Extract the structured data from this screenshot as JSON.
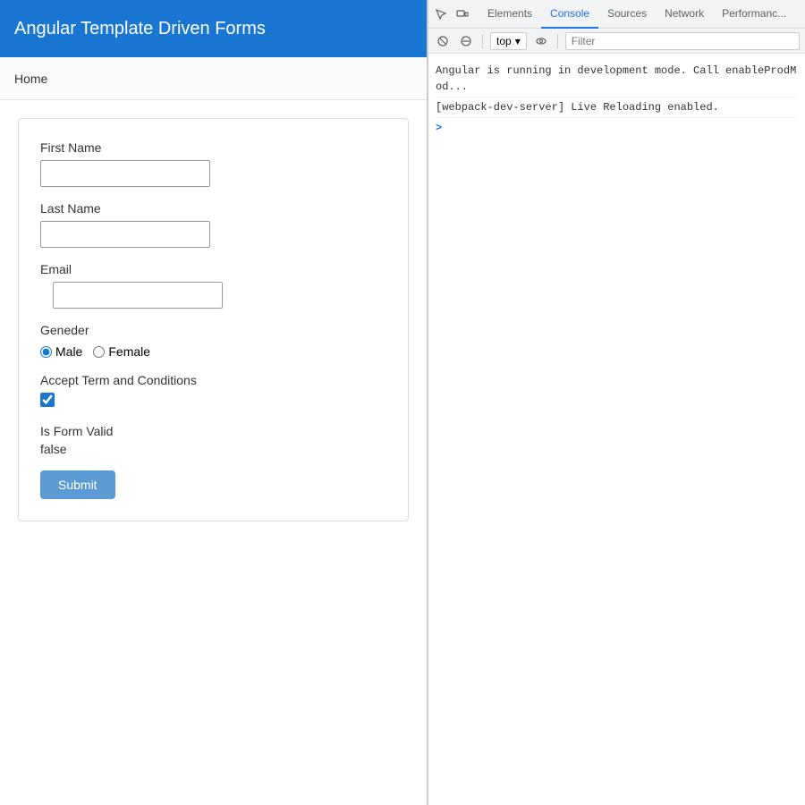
{
  "app": {
    "title": "Angular Template Driven Forms",
    "nav": {
      "home_label": "Home"
    },
    "form": {
      "first_name_label": "First Name",
      "first_name_value": "",
      "first_name_placeholder": "",
      "last_name_label": "Last Name",
      "last_name_value": "",
      "last_name_placeholder": "",
      "email_label": "Email",
      "email_value": "",
      "email_placeholder": "",
      "gender_label": "Geneder",
      "gender_male_label": "Male",
      "gender_female_label": "Female",
      "gender_male_selected": true,
      "gender_female_selected": false,
      "accept_terms_label": "Accept Term and Conditions",
      "accept_terms_checked": true,
      "is_form_valid_label": "Is Form Valid",
      "is_form_valid_value": "false",
      "submit_label": "Submit"
    }
  },
  "devtools": {
    "tabs": [
      {
        "label": "Elements",
        "active": false
      },
      {
        "label": "Console",
        "active": true
      },
      {
        "label": "Sources",
        "active": false
      },
      {
        "label": "Network",
        "active": false
      },
      {
        "label": "Performance",
        "active": false
      }
    ],
    "toolbar": {
      "context_selector": "top",
      "filter_placeholder": "Filter"
    },
    "console": {
      "lines": [
        "Angular is running in development mode. Call enableProdMod...",
        "[webpack-dev-server] Live Reloading enabled."
      ],
      "prompt": ">"
    }
  }
}
